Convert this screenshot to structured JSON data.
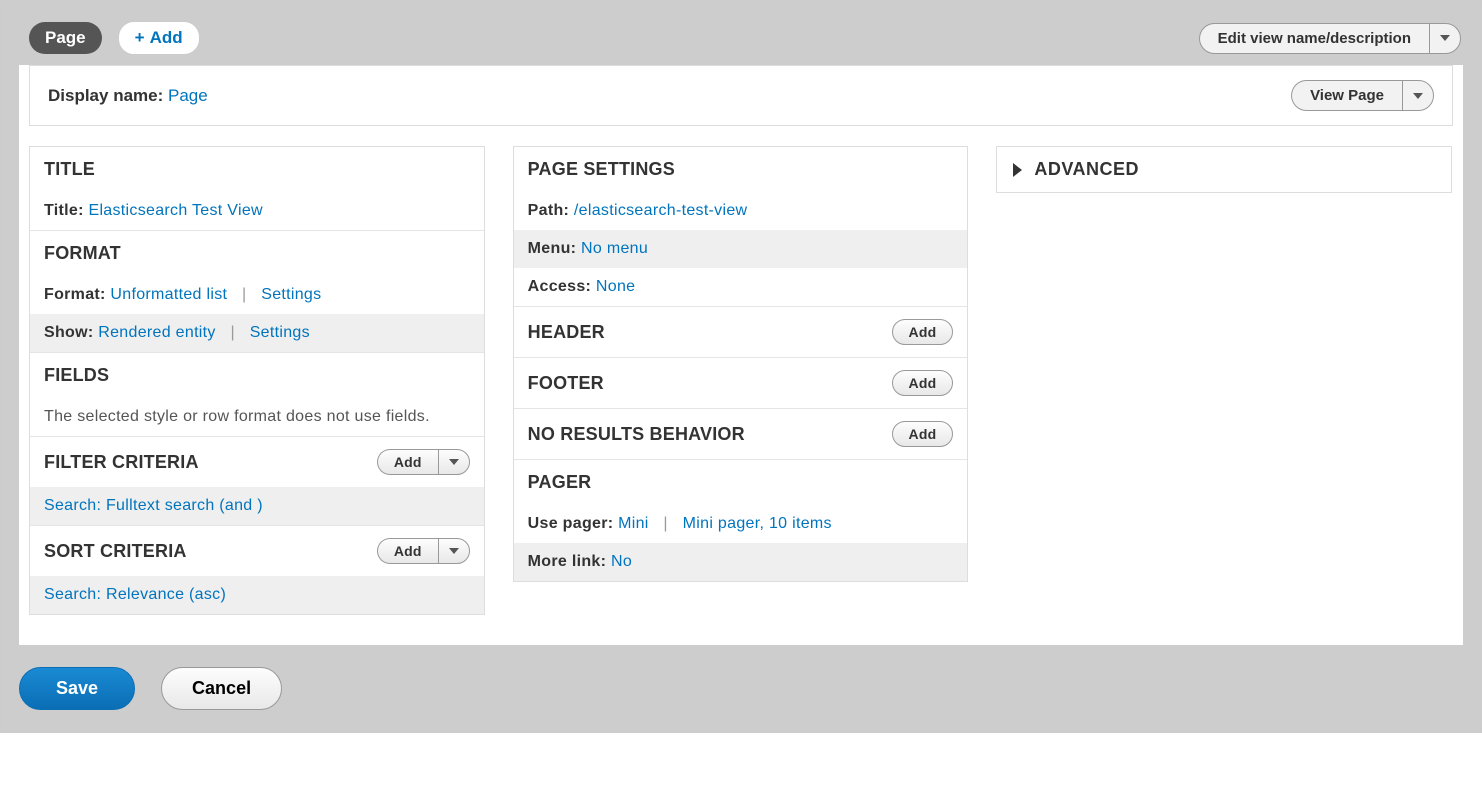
{
  "topbar": {
    "active_tab": "Page",
    "add_label": "Add",
    "edit_view_label": "Edit view name/description"
  },
  "display": {
    "display_name_label": "Display name:",
    "display_name_value": "Page",
    "view_page_label": "View Page"
  },
  "col1": {
    "title_head": "TITLE",
    "title_label": "Title:",
    "title_value": "Elasticsearch Test View",
    "format_head": "FORMAT",
    "format_label": "Format:",
    "format_value": "Unformatted list",
    "settings_label": "Settings",
    "show_label": "Show:",
    "show_value": "Rendered entity",
    "fields_head": "FIELDS",
    "fields_note": "The selected style or row format does not use fields.",
    "filter_head": "FILTER CRITERIA",
    "filter_item": "Search: Fulltext search (and )",
    "sort_head": "SORT CRITERIA",
    "sort_item": "Search: Relevance (asc)",
    "add_btn": "Add"
  },
  "col2": {
    "page_settings_head": "PAGE SETTINGS",
    "path_label": "Path:",
    "path_value": "/elasticsearch-test-view",
    "menu_label": "Menu:",
    "menu_value": "No menu",
    "access_label": "Access:",
    "access_value": "None",
    "header_head": "HEADER",
    "footer_head": "FOOTER",
    "no_results_head": "NO RESULTS BEHAVIOR",
    "pager_head": "PAGER",
    "use_pager_label": "Use pager:",
    "use_pager_value": "Mini",
    "pager_detail": "Mini pager, 10 items",
    "more_link_label": "More link:",
    "more_link_value": "No",
    "add_btn": "Add"
  },
  "advanced": {
    "label": "ADVANCED"
  },
  "footer": {
    "save": "Save",
    "cancel": "Cancel"
  }
}
